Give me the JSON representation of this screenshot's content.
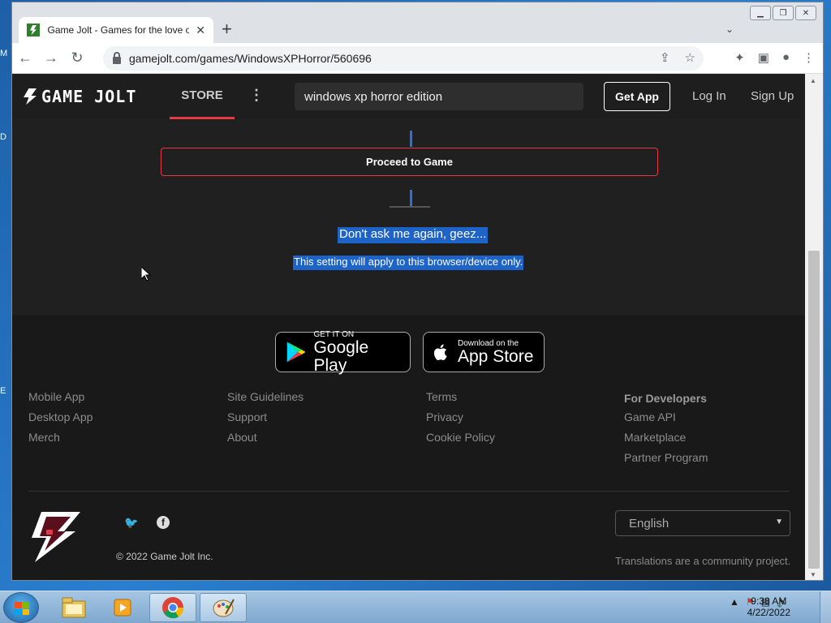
{
  "desktop": {
    "side_letters": [
      "M",
      "D",
      "E"
    ]
  },
  "browser": {
    "tab_title": "Game Jolt - Games for the love o",
    "tab_close": "✕",
    "new_tab": "+",
    "url": "gamejolt.com/games/WindowsXPHorror/560696"
  },
  "header": {
    "logo_text": "GAME JOLT",
    "store_label": "STORE",
    "more_label": "⋮",
    "search_value": "windows xp horror edition",
    "get_app_label": "Get App",
    "login_label": "Log In",
    "signup_label": "Sign Up"
  },
  "main": {
    "proceed_label": "Proceed to Game",
    "dont_ask_label": "Don't ask me again, geez...",
    "setting_note": "This setting will apply to this browser/device only."
  },
  "footer": {
    "google_play": {
      "small": "GET IT ON",
      "big": "Google Play"
    },
    "app_store": {
      "small": "Download on the",
      "big": "App Store"
    },
    "col1": [
      "Mobile App",
      "Desktop App",
      "Merch"
    ],
    "col2": [
      "Site Guidelines",
      "Support",
      "About"
    ],
    "col3": [
      "Terms",
      "Privacy",
      "Cookie Policy"
    ],
    "col4_heading": "For Developers",
    "col4": [
      "Game API",
      "Marketplace",
      "Partner Program"
    ],
    "copyright": "© 2022 Game Jolt Inc.",
    "language": "English",
    "translations_note": "Translations are a community project."
  },
  "taskbar": {
    "time": "9:38 AM",
    "date": "4/22/2022"
  },
  "colors": {
    "accent_red": "#e63946",
    "selection_blue": "#1e64c8",
    "page_bg": "#191919"
  }
}
